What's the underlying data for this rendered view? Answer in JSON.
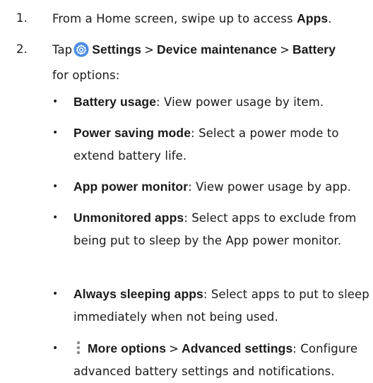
{
  "steps": [
    {
      "number": "1.",
      "text_before": "From a Home screen, swipe up to access ",
      "bold": "Apps",
      "text_after": "."
    },
    {
      "number": "2.",
      "tap": "Tap",
      "icon": "settings-gear-icon",
      "icon_color": "#4b8de6",
      "path": [
        "Settings",
        "Device maintenance",
        "Battery"
      ],
      "separator": ">",
      "text_after": "for options:"
    }
  ],
  "bullets": [
    {
      "term": "Battery usage",
      "description": ": View power usage by item."
    },
    {
      "term": "Power saving mode",
      "description": ": Select a power mode to extend battery life."
    },
    {
      "term": "App power monitor",
      "description": ": View power usage by app."
    },
    {
      "term": "Unmonitored apps",
      "description": ": Select apps to exclude from being put to sleep by the App power monitor."
    },
    {
      "term": "Always sleeping apps",
      "description": ": Select apps to put to sleep immediately when not being used."
    },
    {
      "icon": "more-options-icon",
      "term": "More options",
      "separator": ">",
      "term2": "Advanced settings",
      "description": ": Configure advanced battery settings and notifications."
    }
  ],
  "bullet_char": "•"
}
